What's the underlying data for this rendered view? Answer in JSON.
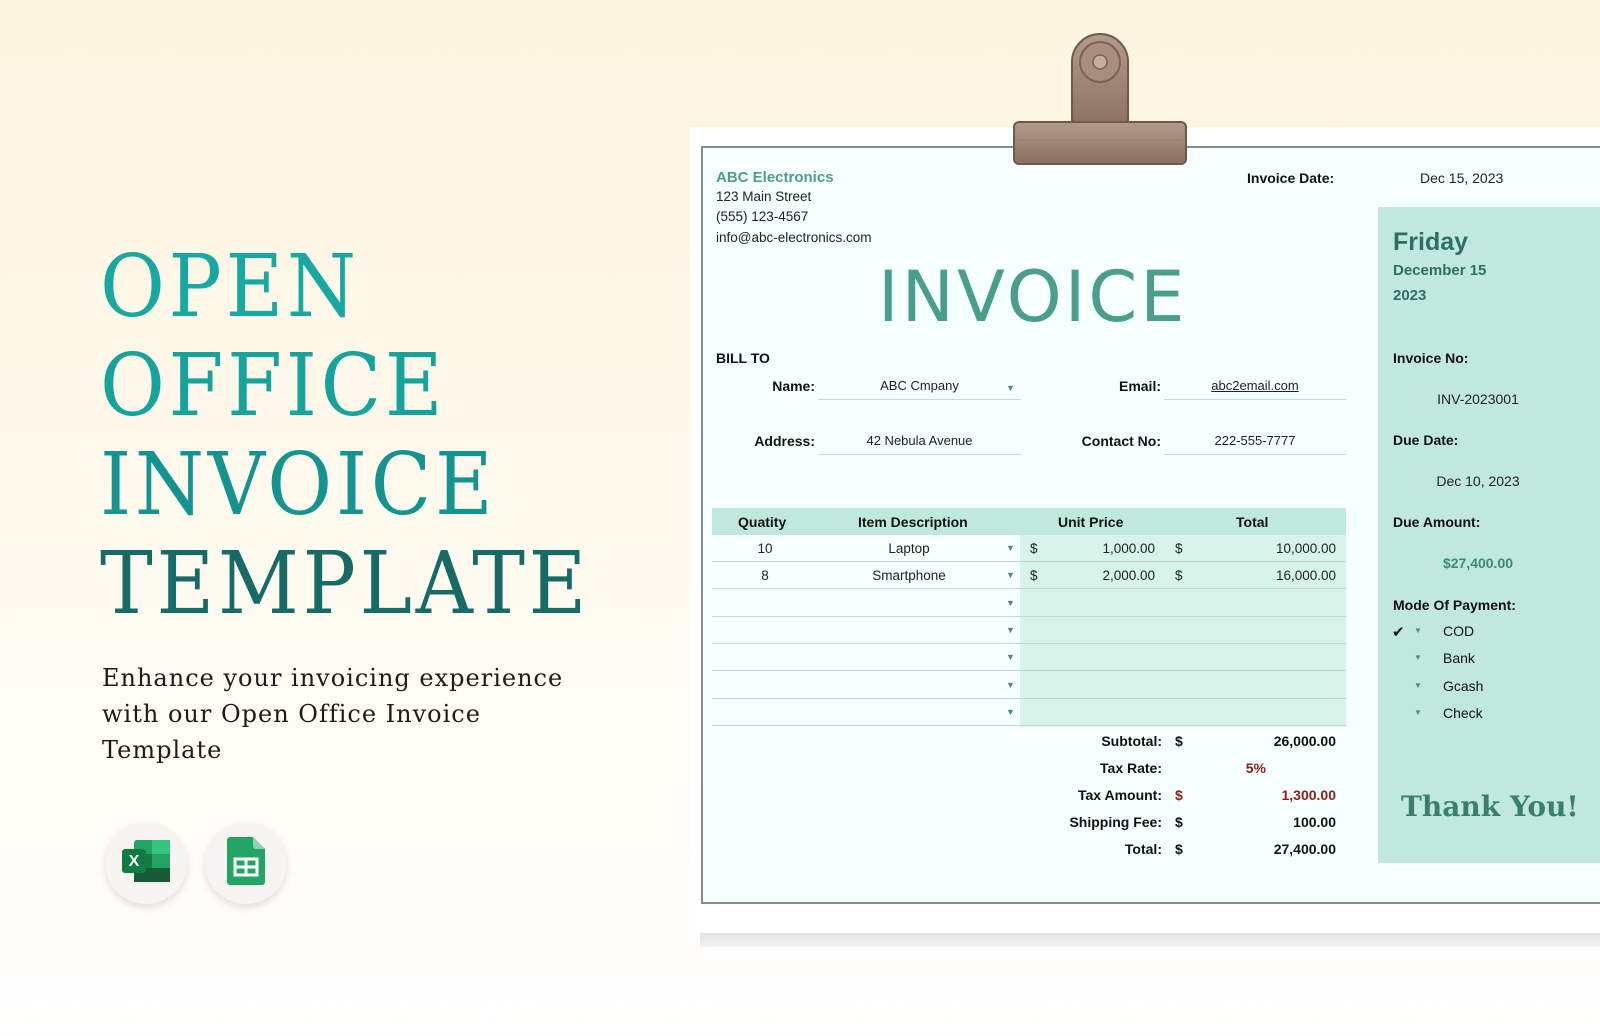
{
  "promo": {
    "title_lines": [
      "OPEN",
      "OFFICE",
      "INVOICE",
      "TEMPLATE"
    ],
    "subtitle": "Enhance your invoicing experience with our Open Office Invoice Template",
    "app_icons": [
      {
        "name": "microsoft-excel-icon",
        "glyph": "X"
      },
      {
        "name": "google-sheets-icon",
        "glyph": ""
      }
    ]
  },
  "invoice": {
    "company": {
      "name": "ABC Electronics",
      "street": "123 Main Street",
      "phone": "(555) 123-4567",
      "email": "info@abc-electronics.com"
    },
    "invoice_date_label": "Invoice Date:",
    "invoice_date_value": "Dec 15, 2023",
    "title": "INVOICE",
    "bill_to": {
      "heading": "BILL TO",
      "name_label": "Name:",
      "name_value": "ABC Cmpany",
      "email_label": "Email:",
      "email_value": "abc2email.com",
      "address_label": "Address:",
      "address_value": "42 Nebula Avenue",
      "contact_label": "Contact No:",
      "contact_value": "222-555-7777"
    },
    "table": {
      "headers": [
        "Quatity",
        "Item Description",
        "Unit Price",
        "Total"
      ],
      "rows": [
        {
          "qty": "10",
          "item": "Laptop",
          "cur1": "$",
          "unit_price": "1,000.00",
          "cur2": "$",
          "total": "10,000.00"
        },
        {
          "qty": "8",
          "item": "Smartphone",
          "cur1": "$",
          "unit_price": "2,000.00",
          "cur2": "$",
          "total": "16,000.00"
        },
        {
          "qty": "",
          "item": "",
          "cur1": "",
          "unit_price": "",
          "cur2": "",
          "total": ""
        },
        {
          "qty": "",
          "item": "",
          "cur1": "",
          "unit_price": "",
          "cur2": "",
          "total": ""
        },
        {
          "qty": "",
          "item": "",
          "cur1": "",
          "unit_price": "",
          "cur2": "",
          "total": ""
        },
        {
          "qty": "",
          "item": "",
          "cur1": "",
          "unit_price": "",
          "cur2": "",
          "total": ""
        },
        {
          "qty": "",
          "item": "",
          "cur1": "",
          "unit_price": "",
          "cur2": "",
          "total": ""
        }
      ]
    },
    "totals": {
      "subtotal_label": "Subtotal:",
      "subtotal_cur": "$",
      "subtotal": "26,000.00",
      "tax_rate_label": "Tax Rate:",
      "tax_rate": "5%",
      "tax_amount_label": "Tax Amount:",
      "tax_amount_cur": "$",
      "tax_amount": "1,300.00",
      "shipping_label": "Shipping Fee:",
      "shipping_cur": "$",
      "shipping": "100.00",
      "total_label": "Total:",
      "total_cur": "$",
      "total": "27,400.00"
    },
    "side": {
      "day": "Friday",
      "month_day": "December 15",
      "year": "2023",
      "invoice_no_label": "Invoice No:",
      "invoice_no": "INV-2023001",
      "due_date_label": "Due Date:",
      "due_date": "Dec 10, 2023",
      "due_amount_label": "Due Amount:",
      "due_amount": "$27,400.00",
      "payment_label": "Mode Of Payment:",
      "payment_options": [
        {
          "label": "COD",
          "checked": "✔"
        },
        {
          "label": "Bank",
          "checked": ""
        },
        {
          "label": "Gcash",
          "checked": ""
        },
        {
          "label": "Check",
          "checked": ""
        }
      ],
      "thanks": "Thank You!"
    },
    "colors": {
      "accent_teal": "#4b9e8c",
      "panel": "#c0e8df",
      "header_row": "#bfe9dd",
      "tax_red": "#8b1c1c"
    }
  }
}
